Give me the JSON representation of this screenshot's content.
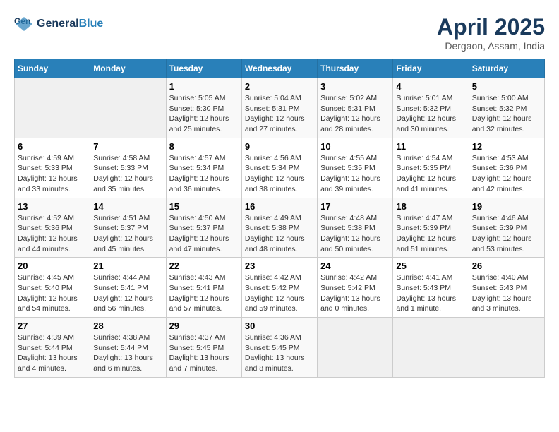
{
  "header": {
    "logo_line1": "General",
    "logo_line2": "Blue",
    "title": "April 2025",
    "location": "Dergaon, Assam, India"
  },
  "days_of_week": [
    "Sunday",
    "Monday",
    "Tuesday",
    "Wednesday",
    "Thursday",
    "Friday",
    "Saturday"
  ],
  "weeks": [
    [
      {
        "day": "",
        "empty": true
      },
      {
        "day": "",
        "empty": true
      },
      {
        "day": "1",
        "sunrise": "5:05 AM",
        "sunset": "5:30 PM",
        "daylight": "12 hours and 25 minutes."
      },
      {
        "day": "2",
        "sunrise": "5:04 AM",
        "sunset": "5:31 PM",
        "daylight": "12 hours and 27 minutes."
      },
      {
        "day": "3",
        "sunrise": "5:02 AM",
        "sunset": "5:31 PM",
        "daylight": "12 hours and 28 minutes."
      },
      {
        "day": "4",
        "sunrise": "5:01 AM",
        "sunset": "5:32 PM",
        "daylight": "12 hours and 30 minutes."
      },
      {
        "day": "5",
        "sunrise": "5:00 AM",
        "sunset": "5:32 PM",
        "daylight": "12 hours and 32 minutes."
      }
    ],
    [
      {
        "day": "6",
        "sunrise": "4:59 AM",
        "sunset": "5:33 PM",
        "daylight": "12 hours and 33 minutes."
      },
      {
        "day": "7",
        "sunrise": "4:58 AM",
        "sunset": "5:33 PM",
        "daylight": "12 hours and 35 minutes."
      },
      {
        "day": "8",
        "sunrise": "4:57 AM",
        "sunset": "5:34 PM",
        "daylight": "12 hours and 36 minutes."
      },
      {
        "day": "9",
        "sunrise": "4:56 AM",
        "sunset": "5:34 PM",
        "daylight": "12 hours and 38 minutes."
      },
      {
        "day": "10",
        "sunrise": "4:55 AM",
        "sunset": "5:35 PM",
        "daylight": "12 hours and 39 minutes."
      },
      {
        "day": "11",
        "sunrise": "4:54 AM",
        "sunset": "5:35 PM",
        "daylight": "12 hours and 41 minutes."
      },
      {
        "day": "12",
        "sunrise": "4:53 AM",
        "sunset": "5:36 PM",
        "daylight": "12 hours and 42 minutes."
      }
    ],
    [
      {
        "day": "13",
        "sunrise": "4:52 AM",
        "sunset": "5:36 PM",
        "daylight": "12 hours and 44 minutes."
      },
      {
        "day": "14",
        "sunrise": "4:51 AM",
        "sunset": "5:37 PM",
        "daylight": "12 hours and 45 minutes."
      },
      {
        "day": "15",
        "sunrise": "4:50 AM",
        "sunset": "5:37 PM",
        "daylight": "12 hours and 47 minutes."
      },
      {
        "day": "16",
        "sunrise": "4:49 AM",
        "sunset": "5:38 PM",
        "daylight": "12 hours and 48 minutes."
      },
      {
        "day": "17",
        "sunrise": "4:48 AM",
        "sunset": "5:38 PM",
        "daylight": "12 hours and 50 minutes."
      },
      {
        "day": "18",
        "sunrise": "4:47 AM",
        "sunset": "5:39 PM",
        "daylight": "12 hours and 51 minutes."
      },
      {
        "day": "19",
        "sunrise": "4:46 AM",
        "sunset": "5:39 PM",
        "daylight": "12 hours and 53 minutes."
      }
    ],
    [
      {
        "day": "20",
        "sunrise": "4:45 AM",
        "sunset": "5:40 PM",
        "daylight": "12 hours and 54 minutes."
      },
      {
        "day": "21",
        "sunrise": "4:44 AM",
        "sunset": "5:41 PM",
        "daylight": "12 hours and 56 minutes."
      },
      {
        "day": "22",
        "sunrise": "4:43 AM",
        "sunset": "5:41 PM",
        "daylight": "12 hours and 57 minutes."
      },
      {
        "day": "23",
        "sunrise": "4:42 AM",
        "sunset": "5:42 PM",
        "daylight": "12 hours and 59 minutes."
      },
      {
        "day": "24",
        "sunrise": "4:42 AM",
        "sunset": "5:42 PM",
        "daylight": "13 hours and 0 minutes."
      },
      {
        "day": "25",
        "sunrise": "4:41 AM",
        "sunset": "5:43 PM",
        "daylight": "13 hours and 1 minute."
      },
      {
        "day": "26",
        "sunrise": "4:40 AM",
        "sunset": "5:43 PM",
        "daylight": "13 hours and 3 minutes."
      }
    ],
    [
      {
        "day": "27",
        "sunrise": "4:39 AM",
        "sunset": "5:44 PM",
        "daylight": "13 hours and 4 minutes."
      },
      {
        "day": "28",
        "sunrise": "4:38 AM",
        "sunset": "5:44 PM",
        "daylight": "13 hours and 6 minutes."
      },
      {
        "day": "29",
        "sunrise": "4:37 AM",
        "sunset": "5:45 PM",
        "daylight": "13 hours and 7 minutes."
      },
      {
        "day": "30",
        "sunrise": "4:36 AM",
        "sunset": "5:45 PM",
        "daylight": "13 hours and 8 minutes."
      },
      {
        "day": "",
        "empty": true
      },
      {
        "day": "",
        "empty": true
      },
      {
        "day": "",
        "empty": true
      }
    ]
  ]
}
